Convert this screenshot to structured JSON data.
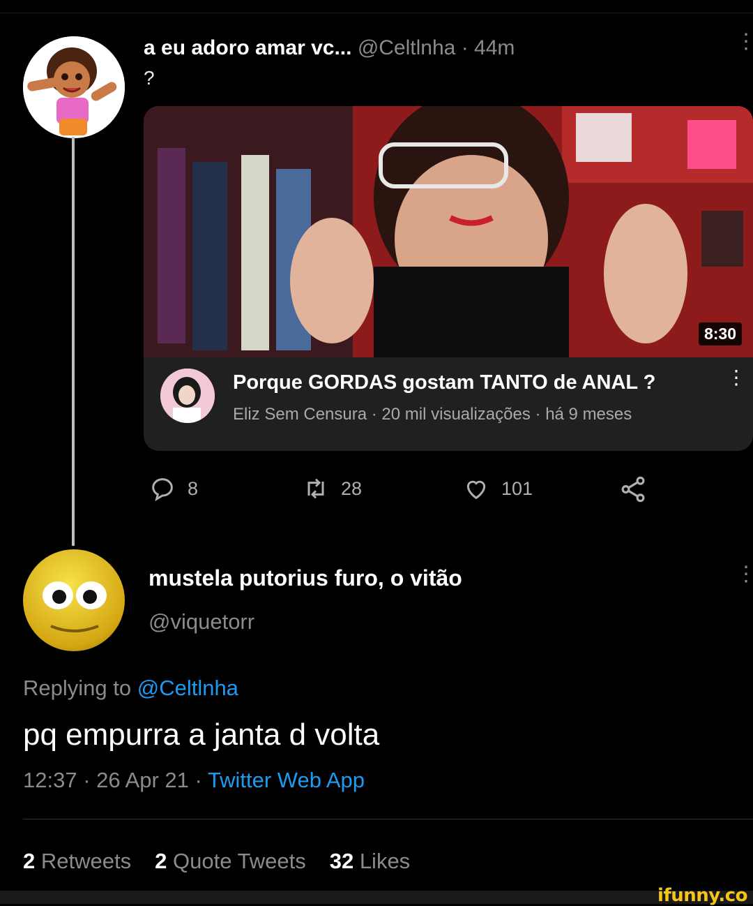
{
  "tweet1": {
    "name": "a eu adoro amar vc...",
    "handle": "@Celtlnha",
    "time": "44m",
    "text": "?"
  },
  "video_card": {
    "duration": "8:30",
    "title": "Porque GORDAS gostam TANTO de ANAL ?",
    "channel": "Eliz Sem Censura",
    "views": "20 mil visualizações",
    "age": "há 9 meses"
  },
  "actions": {
    "replies": "8",
    "retweets": "28",
    "likes": "101"
  },
  "tweet2": {
    "name": "mustela putorius furo, o vitão",
    "handle": "@viquetorr",
    "replying_label": "Replying to",
    "replying_to": "@Celtlnha",
    "text": "pq empurra a janta d volta",
    "time": "12:37",
    "date": "26 Apr 21",
    "source": "Twitter Web App"
  },
  "stats": {
    "retweets_count": "2",
    "retweets_label": "Retweets",
    "quotes_count": "2",
    "quotes_label": "Quote Tweets",
    "likes_count": "32",
    "likes_label": "Likes"
  },
  "watermark": "ifunny.co",
  "icons": [
    "reply-icon",
    "retweet-icon",
    "like-icon",
    "share-icon",
    "more-icon"
  ],
  "colors": {
    "background": "#000000",
    "link": "#1d9bf0",
    "muted": "#8b8b8b"
  }
}
